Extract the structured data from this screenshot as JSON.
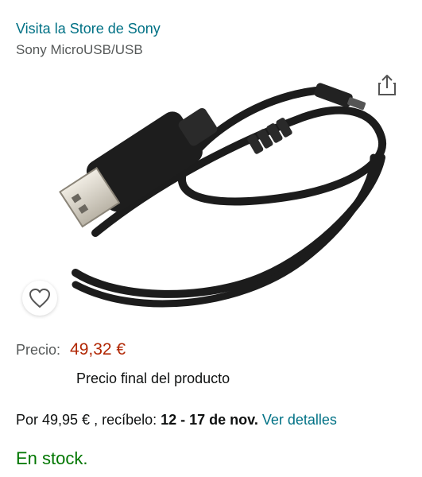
{
  "store_link": "Visita la Store de Sony",
  "product_name": "Sony MicroUSB/USB",
  "icons": {
    "share": "share-icon",
    "wishlist": "heart-icon",
    "product": "usb-cable-image"
  },
  "price": {
    "label": "Precio:",
    "value": "49,32 €",
    "note": "Precio final del producto"
  },
  "delivery": {
    "prefix": "Por 49,95 € , recíbelo: ",
    "dates": "12 - 17 de nov.",
    "details_link": "Ver detalles"
  },
  "stock": "En stock.",
  "colors": {
    "link": "#007185",
    "price": "#b12704",
    "stock": "#007600",
    "muted": "#565959"
  }
}
